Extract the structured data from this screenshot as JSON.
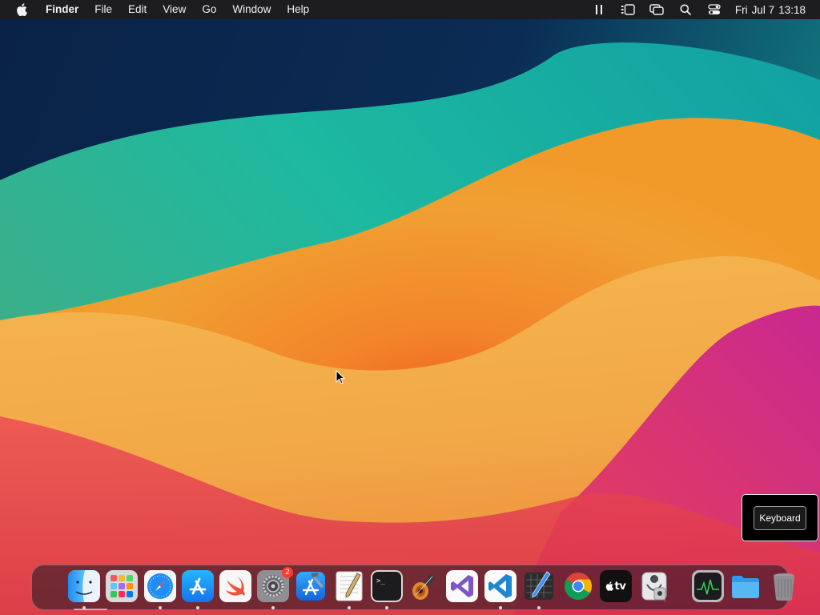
{
  "menubar": {
    "apple_icon": "apple-logo-icon",
    "app_name": "Finder",
    "menus": [
      "File",
      "Edit",
      "View",
      "Go",
      "Window",
      "Help"
    ],
    "status_icons": [
      "sound-waves-icon",
      "stage-manager-icon",
      "screen-mirroring-icon",
      "spotlight-search-icon",
      "control-center-icon"
    ],
    "clock": {
      "day": "Fri",
      "date": "Jul 7",
      "time": "13:18"
    }
  },
  "keyboard_widget": {
    "button_label": "Keyboard"
  },
  "dock": {
    "apps": [
      {
        "name": "Finder",
        "icon": "finder-icon",
        "running": true
      },
      {
        "name": "Launchpad",
        "icon": "launchpad-icon",
        "running": false
      },
      {
        "name": "Safari",
        "icon": "safari-icon",
        "running": true
      },
      {
        "name": "App Store",
        "icon": "app-store-icon",
        "running": true
      },
      {
        "name": "Swift Playgrounds",
        "icon": "swift-icon",
        "running": false
      },
      {
        "name": "System Settings",
        "icon": "system-settings-icon",
        "running": true,
        "badge": "2"
      },
      {
        "name": "Xcode",
        "icon": "xcode-icon",
        "running": false
      },
      {
        "name": "TextEdit",
        "icon": "textedit-icon",
        "running": true
      },
      {
        "name": "Terminal",
        "icon": "terminal-icon",
        "running": true
      },
      {
        "name": "GarageBand",
        "icon": "garageband-icon",
        "running": false
      },
      {
        "name": "Visual Studio",
        "icon": "visual-studio-icon",
        "running": false
      },
      {
        "name": "Visual Studio Code",
        "icon": "vscode-icon",
        "running": true
      },
      {
        "name": "Instruments",
        "icon": "instruments-icon",
        "running": true
      },
      {
        "name": "Google Chrome",
        "icon": "chrome-icon",
        "running": false
      },
      {
        "name": "Apple TV",
        "icon": "apple-tv-icon",
        "running": false,
        "label": "tv"
      },
      {
        "name": "System Information",
        "icon": "system-information-icon",
        "running": false
      },
      {
        "name": "Activity Monitor",
        "icon": "activity-monitor-icon",
        "running": false
      },
      {
        "name": "Downloads",
        "icon": "downloads-folder-icon",
        "running": false
      },
      {
        "name": "Trash",
        "icon": "trash-icon",
        "running": false
      }
    ]
  }
}
